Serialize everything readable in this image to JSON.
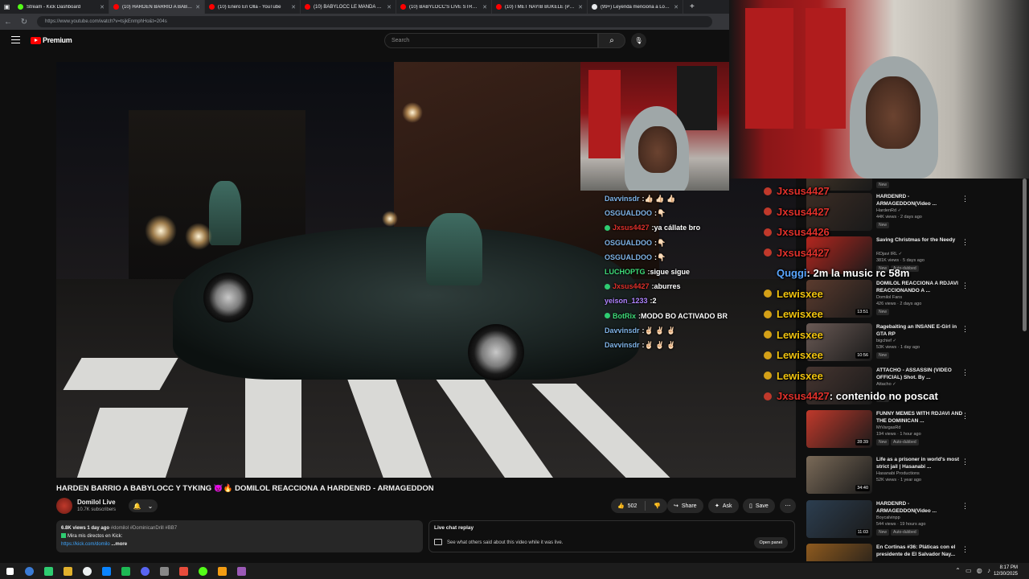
{
  "browser": {
    "tabs": [
      {
        "label": "Stream - Kick Dashboard",
        "color": "#53fc18"
      },
      {
        "label": "(10) HARDEN BARRIO A BABYLOCC",
        "color": "#ff0000",
        "active": true
      },
      {
        "label": "(10) Enero En Olla - YouTube",
        "color": "#ff0000"
      },
      {
        "label": "(10) BABYLOCC LE MANDA 🔥 A HARDEN",
        "color": "#ff0000"
      },
      {
        "label": "(10) BABYLOCC'S LIVE STREAM REACTION",
        "color": "#ff0000"
      },
      {
        "label": "(10) I MET NAYIB BUKELE (PRESIDENT",
        "color": "#ff0000"
      },
      {
        "label": "(99+) Leyenda menciona a Los Bravos",
        "color": "#e8eaed"
      }
    ],
    "url": "https://www.youtube.com/watch?v=tsjkEnmphHo&t=204s"
  },
  "youtube": {
    "logo_text": "Premium",
    "search_placeholder": "Search"
  },
  "video": {
    "title": "HARDEN BARRIO A BABYLOCC Y TYKING 😈🔥 DOMILOL REACCIONA A HARDENRD - ARMAGEDDON",
    "channel": "Domilol Live",
    "subscribers": "10.7K subscribers",
    "likes": "502",
    "share_label": "Share",
    "ask_label": "Ask",
    "save_label": "Save",
    "description": {
      "stats": "6.8K views  1 day ago",
      "hashtags": "#domilol #DominicanDrill #BB7",
      "line2": "Mira mis directos en Kick:",
      "link": "https://kick.com/domilo",
      "more": "...more"
    }
  },
  "chat_replay": {
    "header": "Live chat replay",
    "subtitle": "See what others said about this video while it was live.",
    "button": "Open panel"
  },
  "stream_chat": [
    {
      "user": "Davvinsdr",
      "sep": " :",
      "text": " 👍🏻 👍🏻 👍🏻",
      "color": "#7fb3e6",
      "badge": false
    },
    {
      "user": "OSGUALDOO",
      "sep": " :",
      "text": " 👇🏻",
      "color": "#7fb3e6",
      "badge": false
    },
    {
      "user": "Jxsus4427",
      "sep": " :",
      "text": " ya cállate bro",
      "color": "#e0312b",
      "badge": true
    },
    {
      "user": "OSGUALDOO",
      "sep": " :",
      "text": " 👇🏻",
      "color": "#7fb3e6",
      "badge": false
    },
    {
      "user": "OSGUALDOO",
      "sep": " :",
      "text": " 👇🏻",
      "color": "#7fb3e6",
      "badge": false
    },
    {
      "user": "LUCHOPTG",
      "sep": " :",
      "text": " sigue sigue",
      "color": "#3fdc7a",
      "badge": false
    },
    {
      "user": "Jxsus4427",
      "sep": " :",
      "text": " aburres",
      "color": "#e0312b",
      "badge": true
    },
    {
      "user": "yeison_1233",
      "sep": " :",
      "text": " 2",
      "color": "#b084ff",
      "badge": false
    },
    {
      "user": "BotRix",
      "sep": " :",
      "text": " MODO BO ACTIVADO BR",
      "color": "#3fdc7a",
      "badge": true
    },
    {
      "user": "Davvinsdr",
      "sep": " :",
      "text": " ✌🏻 ✌🏻 ✌🏻",
      "color": "#7fb3e6",
      "badge": false
    },
    {
      "user": "Davvinsdr",
      "sep": " :",
      "text": " ✌🏻 ✌🏻 ✌🏻",
      "color": "#7fb3e6",
      "badge": false
    }
  ],
  "overlay_chat": [
    {
      "user": "Jxsus4427",
      "text": "",
      "color": "#e0312b",
      "badge_color": "#c0392b"
    },
    {
      "user": "Jxsus4427",
      "text": "",
      "color": "#e0312b",
      "badge_color": "#c0392b"
    },
    {
      "user": "Jxsus4426",
      "text": "",
      "color": "#e0312b",
      "badge_color": "#c0392b"
    },
    {
      "user": "Jxsus4427",
      "text": "",
      "color": "#e0312b",
      "badge_color": "#c0392b"
    },
    {
      "user": "Quggi",
      "text": ": 2m la music rc 58m",
      "color": "#5aa6ff",
      "badge_color": ""
    },
    {
      "user": "Lewisxee",
      "text": "",
      "color": "#f1c40f",
      "badge_color": "#d4a017"
    },
    {
      "user": "Lewisxee",
      "text": "",
      "color": "#f1c40f",
      "badge_color": "#d4a017"
    },
    {
      "user": "Lewisxee",
      "text": "",
      "color": "#f1c40f",
      "badge_color": "#d4a017"
    },
    {
      "user": "Lewisxee",
      "text": "",
      "color": "#f1c40f",
      "badge_color": "#d4a017"
    },
    {
      "user": "Lewisxee",
      "text": "",
      "color": "#f1c40f",
      "badge_color": "#d4a017"
    },
    {
      "user": "Jxsus4427",
      "text": ": contenido no poscat",
      "color": "#e0312b",
      "badge_color": "#c0392b"
    }
  ],
  "recommendations": [
    {
      "title": "",
      "channel": "",
      "meta": "8 views · 4 days ago",
      "tags": [
        "New"
      ],
      "duration": "",
      "thumb": "#4a3a2a"
    },
    {
      "title": "HARDENRD - ARMAGEDDON(Video ...",
      "channel": "HardenRd ✓",
      "meta": "44K views · 2 days ago",
      "tags": [
        "New"
      ],
      "duration": "",
      "thumb": "#3b2c24"
    },
    {
      "title": "Saving Christmas for the Needy",
      "channel": "RDjavi IRL ✓",
      "meta": "381K views · 5 days ago",
      "tags": [
        "New",
        "Auto-dubbed"
      ],
      "duration": "",
      "thumb": "#b3261e"
    },
    {
      "title": "DOMILOL REACCIONA A RDJAVI REACCIONANDO A ...",
      "channel": "Domilol Fans",
      "meta": "426 views · 2 days ago",
      "tags": [
        "New"
      ],
      "duration": "13:51",
      "thumb": "#5b3b2e"
    },
    {
      "title": "Ragebaiting an INSANE E-Girl in GTA RP",
      "channel": "bigchief ✓",
      "meta": "53K views · 1 day ago",
      "tags": [
        "New"
      ],
      "duration": "10:56",
      "thumb": "#6a5a55"
    },
    {
      "title": "ATTACHO - ASSASSIN (VIDEO OFFICIAL) Shot. By ...",
      "channel": "Attacho ✓",
      "meta": "",
      "tags": [
        "New"
      ],
      "duration": "",
      "thumb": "#463530"
    },
    {
      "title": "FUNNY MEMES WITH RDJAVI AND THE DOMINICAN ...",
      "channel": "MrVargasRd",
      "meta": "194 views · 1 hour ago",
      "tags": [
        "New",
        "Auto-dubbed"
      ],
      "duration": "28:39",
      "thumb": "#c0392b"
    },
    {
      "title": "Life as a prisoner in world's most strict jail | Hasanabi ...",
      "channel": "Hasanabi Productions",
      "meta": "52K views · 1 year ago",
      "tags": [],
      "duration": "34:40",
      "thumb": "#7a6a58"
    },
    {
      "title": "HARDENRD - ARMAGEDDON(Video ...",
      "channel": "Boycalvinpp",
      "meta": "544 views · 19 hours ago",
      "tags": [
        "New",
        "Auto-dubbed"
      ],
      "duration": "11:03",
      "thumb": "#2c3e50"
    },
    {
      "title": "En Cortinas #36: Pláticas con el presidente de El Salvador Nay...",
      "channel": "",
      "meta": "",
      "tags": [],
      "duration": "",
      "thumb": "#8e5a1e"
    }
  ],
  "taskbar": {
    "time": "8:17 PM",
    "date": "12/30/2025",
    "icons": [
      "#3a7bd5",
      "#2ecc71",
      "#e1b12c",
      "#ecf0f1",
      "#0a84ff",
      "#1db954",
      "#5865f2",
      "#888888",
      "#e74c3c",
      "#53fc18",
      "#f39c12",
      "#9b59b6"
    ]
  }
}
